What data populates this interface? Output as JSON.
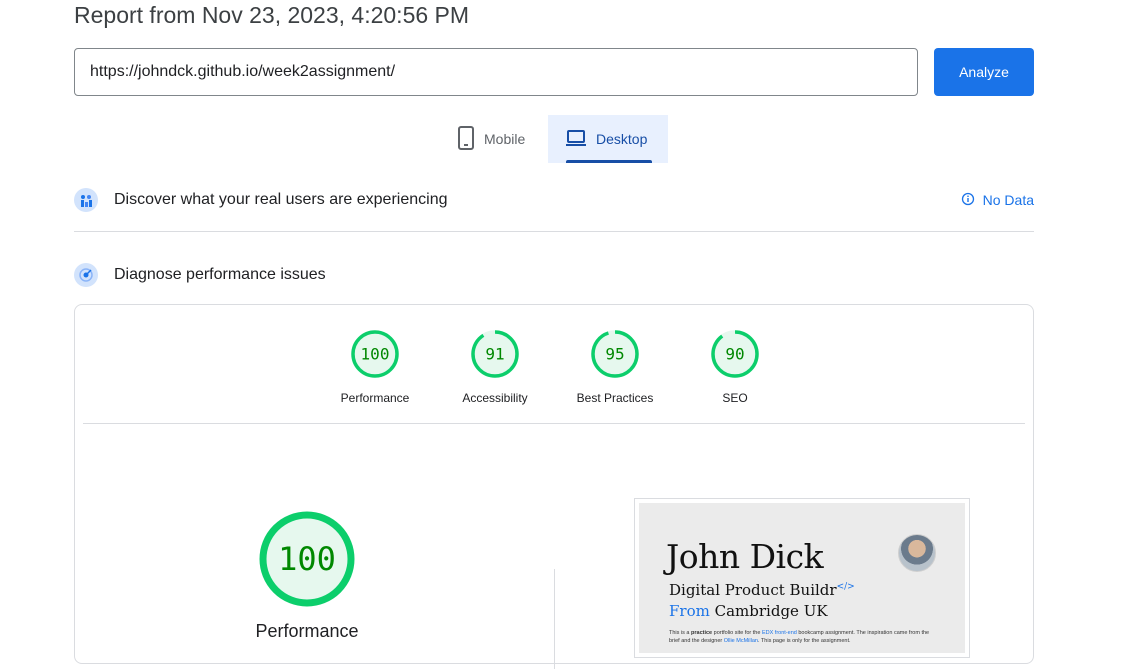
{
  "report": {
    "title": "Report from Nov 23, 2023, 4:20:56 PM"
  },
  "search": {
    "url": "https://johndck.github.io/week2assignment/",
    "analyze_label": "Analyze"
  },
  "tabs": [
    {
      "label": "Mobile",
      "icon": "smartphone-icon",
      "selected": false
    },
    {
      "label": "Desktop",
      "icon": "laptop-icon",
      "selected": true
    }
  ],
  "real_users": {
    "heading": "Discover what your real users are experiencing",
    "status": "No Data"
  },
  "diagnose": {
    "heading": "Diagnose performance issues"
  },
  "scores": [
    {
      "value": "100",
      "label": "Performance"
    },
    {
      "value": "91",
      "label": "Accessibility"
    },
    {
      "value": "95",
      "label": "Best Practices"
    },
    {
      "value": "90",
      "label": "SEO"
    }
  ],
  "main_score": {
    "value": "100",
    "label": "Performance"
  },
  "colors": {
    "pass": "#0cce6b",
    "pass_fill": "#e6f8ee",
    "pass_text": "#008800",
    "accent": "#1a73e8"
  },
  "screenshot": {
    "name": "John Dick",
    "role": "Digital Product Buildr",
    "code": "</>",
    "from": "From",
    "location": "Cambridge UK",
    "desc_1": "This is a ",
    "desc_bold": "practice",
    "desc_2": " portfolio site for the ",
    "desc_link1": "EDX front-end",
    "desc_3": " bookcamp assignment. The inspiration came from the brief and the designer ",
    "desc_link2": "Ollie McMillan",
    "desc_4": ". This page is only for the assignment."
  }
}
